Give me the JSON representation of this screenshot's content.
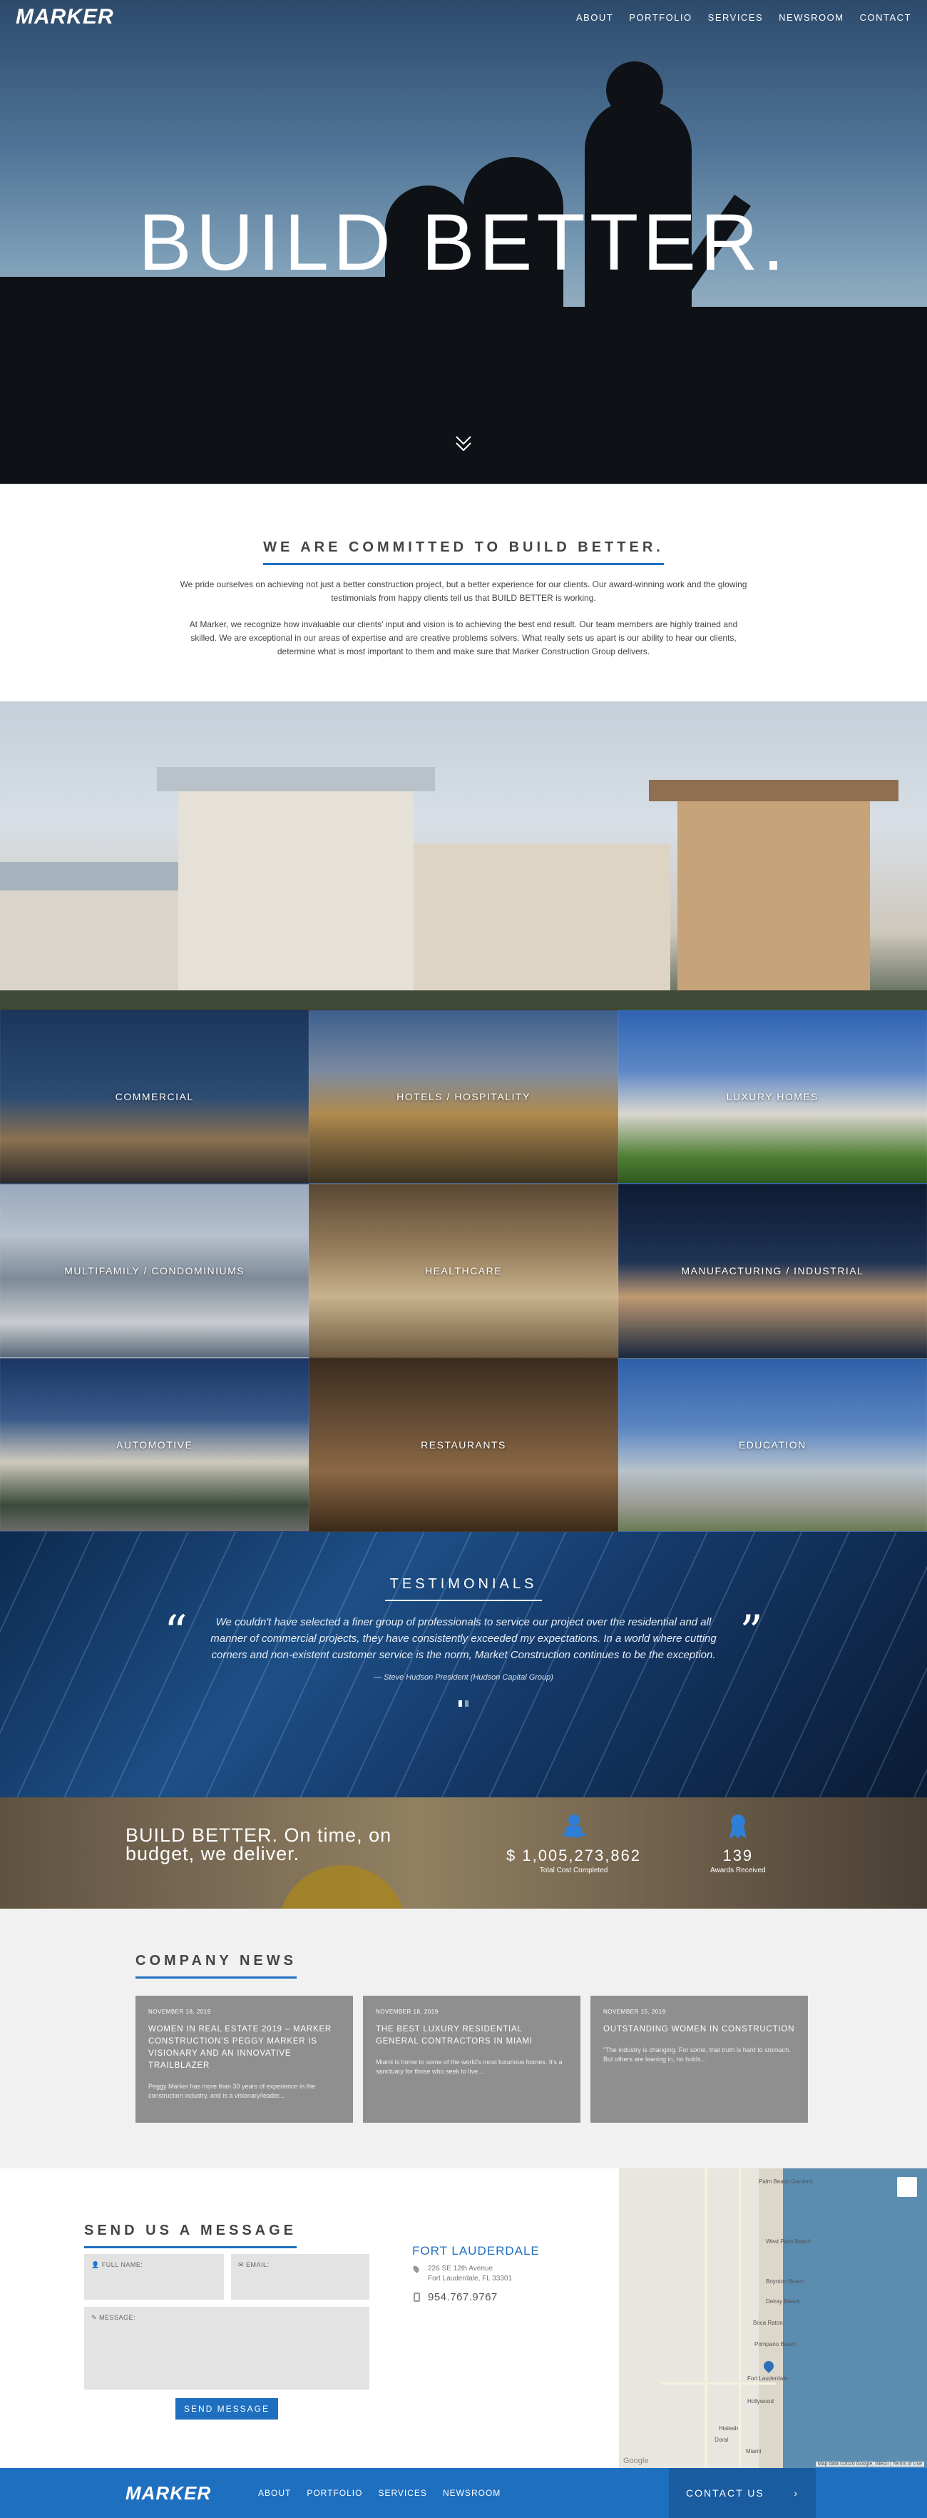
{
  "header": {
    "logo": "MARKER",
    "nav": [
      "ABOUT",
      "PORTFOLIO",
      "SERVICES",
      "NEWSROOM",
      "CONTACT"
    ]
  },
  "hero": {
    "title": "BUILD BETTER.",
    "scroll_icon": "double-chevron-down-icon"
  },
  "committed": {
    "heading": "WE ARE COMMITTED TO BUILD BETTER.",
    "lead": "We pride ourselves on achieving not just a better construction project, but a better experience for our clients. Our award-winning work and the glowing testimonials from happy clients tell us that BUILD BETTER is working.",
    "body": "At Marker, we recognize how invaluable our clients' input and vision is to achieving the best end result. Our team members are highly trained and skilled. We are exceptional in our areas of expertise and are creative problems solvers. What really sets us apart is our ability to hear our clients, determine what is most important to them and make sure that Marker Construction Group delivers."
  },
  "portfolio": [
    {
      "label": "COMMERCIAL"
    },
    {
      "label": "HOTELS / HOSPITALITY"
    },
    {
      "label": "LUXURY HOMES"
    },
    {
      "label": "MULTIFAMILY / CONDOMINIUMS"
    },
    {
      "label": "HEALTHCARE"
    },
    {
      "label": "MANUFACTURING / INDUSTRIAL"
    },
    {
      "label": "AUTOMOTIVE"
    },
    {
      "label": "RESTAURANTS"
    },
    {
      "label": "EDUCATION"
    }
  ],
  "testimonials": {
    "heading": "TESTIMONIALS",
    "quote": "We couldn't have selected a finer group of professionals to service our project over the residential and all manner of commercial projects, they have consistently exceeded my expectations. In a world where cutting corners and non-existent customer service is the norm, Market Construction continues to be the exception.",
    "author": "— Steve Hudson President (Hudson Capital Group)"
  },
  "stats": {
    "tagline": "BUILD BETTER. On time, on budget, we deliver.",
    "items": [
      {
        "value": "$ 1,005,273,862",
        "label": "Total Cost Completed",
        "icon": "worker-icon"
      },
      {
        "value": "139",
        "label": "Awards Received",
        "icon": "award-icon"
      }
    ]
  },
  "news": {
    "heading": "COMPANY NEWS",
    "cards": [
      {
        "date": "NOVEMBER 18, 2019",
        "title": "WOMEN IN REAL ESTATE 2019 – MARKER CONSTRUCTION'S PEGGY MARKER IS VISIONARY AND AN INNOVATIVE TRAILBLAZER",
        "excerpt": "Peggy Marker has more than 30 years of experience in the construction industry, and is a visionary/leader..."
      },
      {
        "date": "NOVEMBER 18, 2019",
        "title": "THE BEST LUXURY RESIDENTIAL GENERAL CONTRACTORS IN MIAMI",
        "excerpt": "Miami is home to some of the world's most luxurious homes. It's a sanctuary for those who seek to live..."
      },
      {
        "date": "NOVEMBER 15, 2019",
        "title": "OUTSTANDING WOMEN IN CONSTRUCTION",
        "excerpt": "\"The industry is changing. For some, that truth is hard to stomach. But others are leaning in, no holds..."
      }
    ]
  },
  "contact": {
    "heading": "SEND US A MESSAGE",
    "full_name_label": "FULL NAME:",
    "email_label": "EMAIL:",
    "message_label": "MESSAGE:",
    "send_label": "SEND MESSAGE",
    "office": {
      "city": "FORT LAUDERDALE",
      "address1": "226 SE 12th Avenue",
      "address2": "Fort Lauderdale, FL 33301",
      "phone": "954.767.9767"
    },
    "map": {
      "places": [
        "Palm Beach Gardens",
        "West Palm Beach",
        "Boynton Beach",
        "Delray Beach",
        "Boca Raton",
        "Pompano Beach",
        "Fort Lauderdale",
        "Hollywood",
        "Hialeah",
        "Doral",
        "Miami"
      ],
      "credit": "Map data ©2020 Google, INEGI | Terms of Use",
      "google": "Google"
    }
  },
  "footer": {
    "logo": "MARKER",
    "nav": [
      "ABOUT",
      "PORTFOLIO",
      "SERVICES",
      "NEWSROOM"
    ],
    "cta": "CONTACT US",
    "cta_arrow": "›"
  },
  "colors": {
    "accent": "#1f6fc1",
    "card": "#8f8f8f",
    "news_bg": "#f1f1f1"
  }
}
